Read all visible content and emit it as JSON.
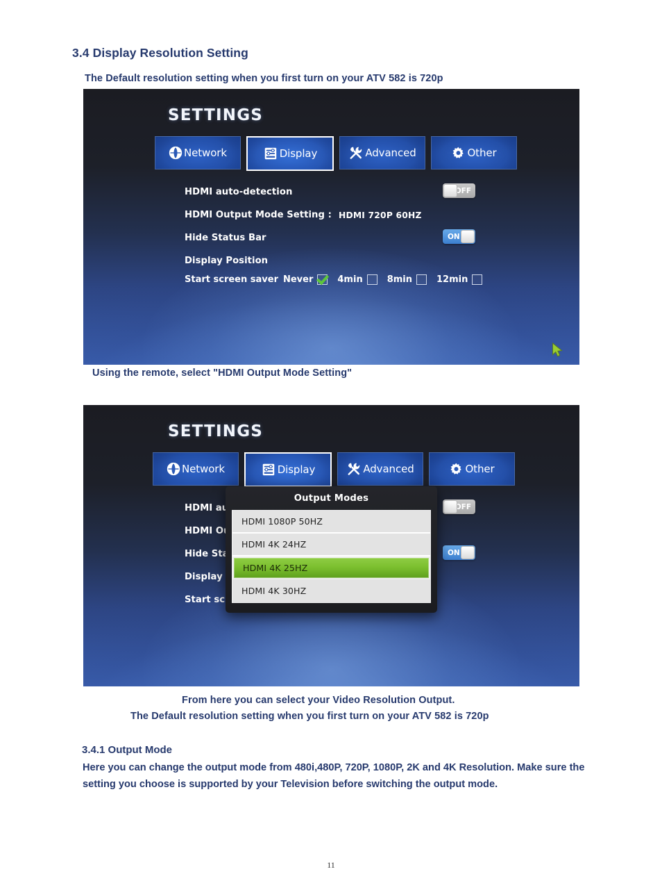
{
  "document": {
    "heading": "3.4 Display Resolution Setting",
    "intro_line": "The Default resolution setting when you first turn on your ATV 582 is 720p",
    "caption_between": "Using the remote, select \"HDMI Output Mode Setting\"",
    "caption_below_1": "From here you can select your Video Resolution Output.",
    "caption_below_2": "The Default resolution setting when you first turn on your ATV 582 is 720p",
    "subheading": "3.4.1 Output Mode",
    "body_paragraph": "Here you can change the output mode from 480i,480P, 720P, 1080P, 2K and 4K Resolution. Make sure the setting you choose is supported by your Television before switching the output mode.",
    "page_number": "11",
    "text_color": "#26396d"
  },
  "screenshot_one": {
    "title": "SETTINGS",
    "tabs": [
      {
        "label": "Network",
        "icon": "globe-icon",
        "selected": false
      },
      {
        "label": "Display",
        "icon": "sliders-icon",
        "selected": true
      },
      {
        "label": "Advanced",
        "icon": "tools-icon",
        "selected": false
      },
      {
        "label": "Other",
        "icon": "gear-icon",
        "selected": false
      }
    ],
    "options": {
      "hdmi_auto_detection_label": "HDMI auto-detection",
      "hdmi_auto_detection_state": "OFF",
      "hdmi_output_mode_label": "HDMI Output Mode Setting :",
      "hdmi_output_mode_value": "HDMI 720P 60HZ",
      "hide_status_bar_label": "Hide Status Bar",
      "hide_status_bar_state": "ON",
      "display_position_label": "Display Position"
    },
    "screen_saver": {
      "label": "Start screen saver",
      "choices": [
        {
          "text": "Never",
          "checked": true
        },
        {
          "text": "4min",
          "checked": false
        },
        {
          "text": "8min",
          "checked": false
        },
        {
          "text": "12min",
          "checked": false
        }
      ],
      "check_color": "#5dc63a"
    },
    "cursor": {
      "icon": "mouse-pointer-icon",
      "color": "#9acd32"
    }
  },
  "screenshot_two": {
    "title": "SETTINGS",
    "tabs": [
      {
        "label": "Network",
        "icon": "globe-icon",
        "selected": false
      },
      {
        "label": "Display",
        "icon": "sliders-icon",
        "selected": true
      },
      {
        "label": "Advanced",
        "icon": "tools-icon",
        "selected": false
      },
      {
        "label": "Other",
        "icon": "gear-icon",
        "selected": false
      }
    ],
    "options": {
      "hdmi_auto_detection_label": "HDMI auto-detection",
      "hdmi_auto_detection_state": "OFF",
      "hdmi_output_mode_label": "HDMI Outp",
      "hide_status_bar_label": "Hide Statu",
      "display_position_label": "Display Po",
      "screen_saver_label": "Start scree",
      "hide_status_bar_state": "ON"
    },
    "dialog": {
      "title": "Output Modes",
      "items": [
        {
          "label": "HDMI 1080P 50HZ",
          "selected": false
        },
        {
          "label": "HDMI 4K 24HZ",
          "selected": false
        },
        {
          "label": "HDMI 4K 25HZ",
          "selected": true
        },
        {
          "label": "HDMI 4K 30HZ",
          "selected": false
        }
      ],
      "highlight_color": "#7cc02f"
    }
  }
}
